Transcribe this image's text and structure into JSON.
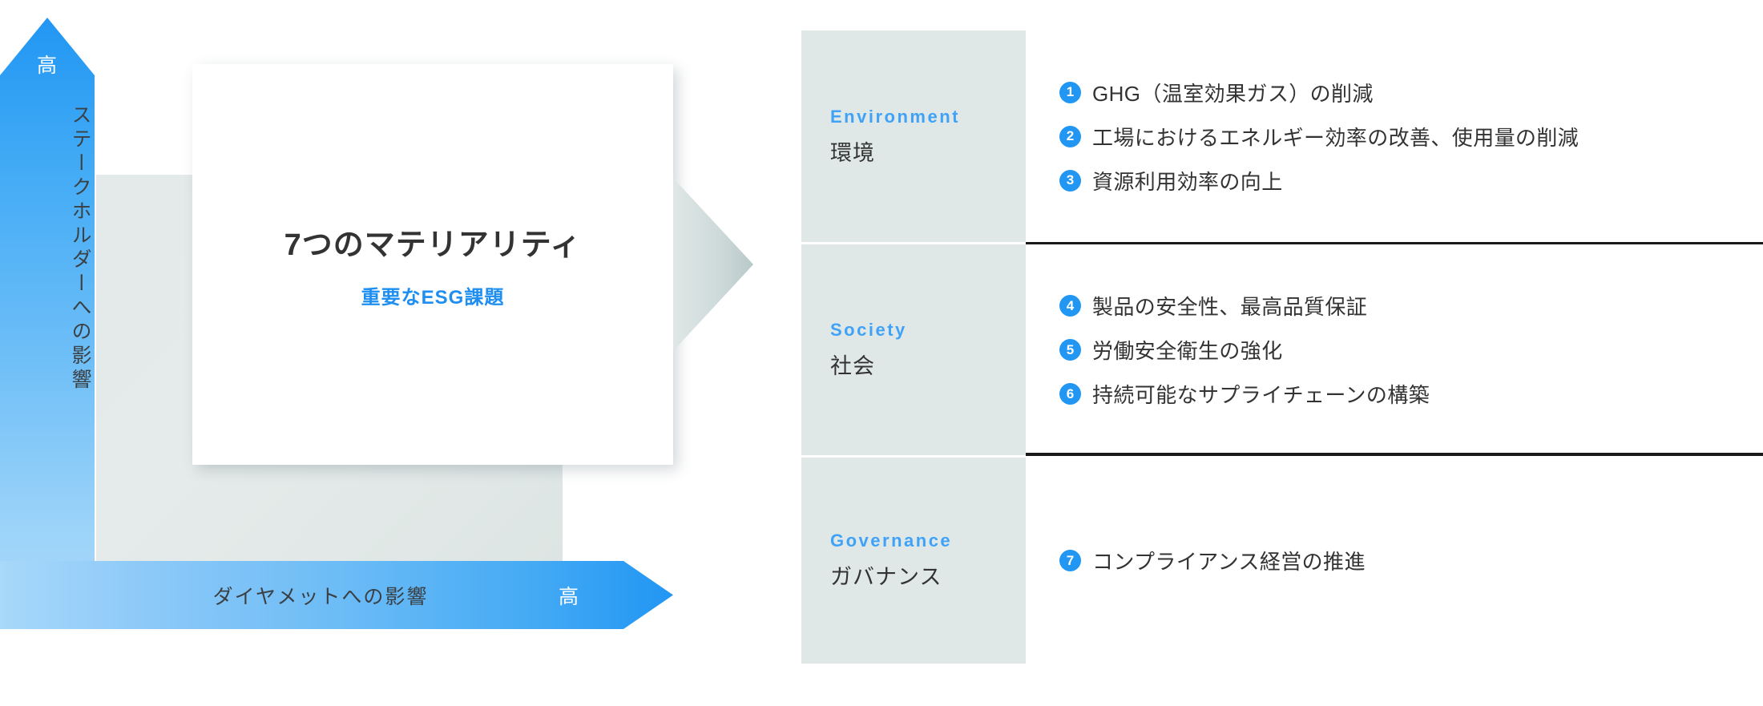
{
  "matrix": {
    "vertical_axis": {
      "high_label": "高",
      "title": "ステークホルダーへの影響"
    },
    "horizontal_axis": {
      "high_label": "高",
      "title": "ダイヤメットへの影響"
    },
    "card": {
      "title": "7つのマテリアリティ",
      "subtitle": "重要なESG課題"
    }
  },
  "colors": {
    "accent_blue": "#2196f3",
    "label_blue": "#3fa2f7",
    "panel_grey": "#e0e8e7",
    "plot_grey": "#e3eae9",
    "text_dark": "#333333"
  },
  "panel": {
    "sections": [
      {
        "label_en": "Environment",
        "label_ja": "環境",
        "items": [
          {
            "num": "1",
            "text": "GHG（温室効果ガス）の削減"
          },
          {
            "num": "2",
            "text": "工場におけるエネルギー効率の改善、使用量の削減"
          },
          {
            "num": "3",
            "text": "資源利用効率の向上"
          }
        ]
      },
      {
        "label_en": "Society",
        "label_ja": "社会",
        "items": [
          {
            "num": "4",
            "text": "製品の安全性、最高品質保証"
          },
          {
            "num": "5",
            "text": "労働安全衛生の強化"
          },
          {
            "num": "6",
            "text": "持続可能なサプライチェーンの構築"
          }
        ]
      },
      {
        "label_en": "Governance",
        "label_ja": "ガバナンス",
        "items": [
          {
            "num": "7",
            "text": "コンプライアンス経営の推進"
          }
        ]
      }
    ]
  }
}
